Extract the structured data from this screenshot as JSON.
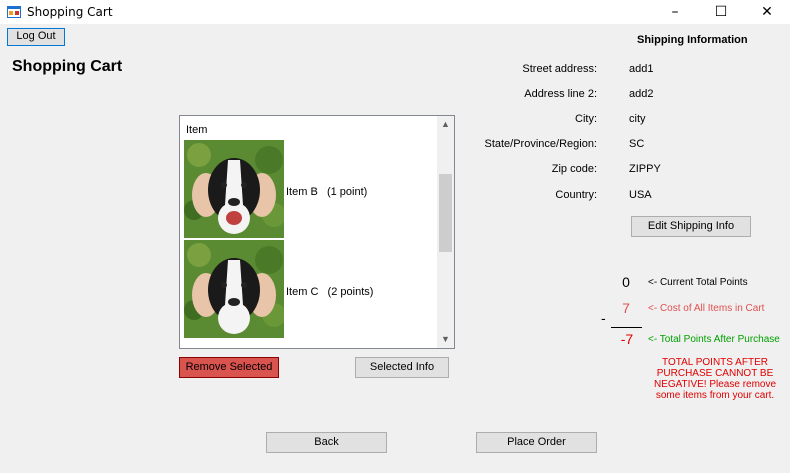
{
  "window": {
    "title": "Shopping Cart",
    "minimize": "–",
    "maximize": "☐",
    "close": "✕"
  },
  "toolbar": {
    "logout_label": "Log Out"
  },
  "page": {
    "heading": "Shopping Cart"
  },
  "shipping": {
    "heading": "Shipping Information",
    "fields": [
      {
        "label": "Street address:",
        "value": "add1"
      },
      {
        "label": "Address line 2:",
        "value": "add2"
      },
      {
        "label": "City:",
        "value": "city"
      },
      {
        "label": "State/Province/Region:",
        "value": "SC"
      },
      {
        "label": "Zip code:",
        "value": "ZIPPY"
      },
      {
        "label": "Country:",
        "value": "USA"
      }
    ],
    "edit_label": "Edit Shipping Info"
  },
  "cart": {
    "header": "Item",
    "items": [
      {
        "text": "Item B   (1 point)",
        "image_icon": "dog-photo"
      },
      {
        "text": "Item C   (2 points)",
        "image_icon": "dog-photo"
      }
    ],
    "remove_label": "Remove Selected",
    "info_label": "Selected Info"
  },
  "points": {
    "current_value": "0",
    "current_label": "<- Current Total Points",
    "cost_value": "7",
    "cost_label": "<- Cost of All Items in Cart",
    "minus_sign": "-",
    "after_value": "-7",
    "after_label": "<- Total Points After Purchase",
    "warning": "TOTAL POINTS AFTER PURCHASE CANNOT BE NEGATIVE! Please remove some items from your cart.",
    "cost_color": "#e05050",
    "after_color": "#e00000",
    "after_label_color": "#00a000"
  },
  "footer": {
    "back_label": "Back",
    "order_label": "Place Order"
  }
}
